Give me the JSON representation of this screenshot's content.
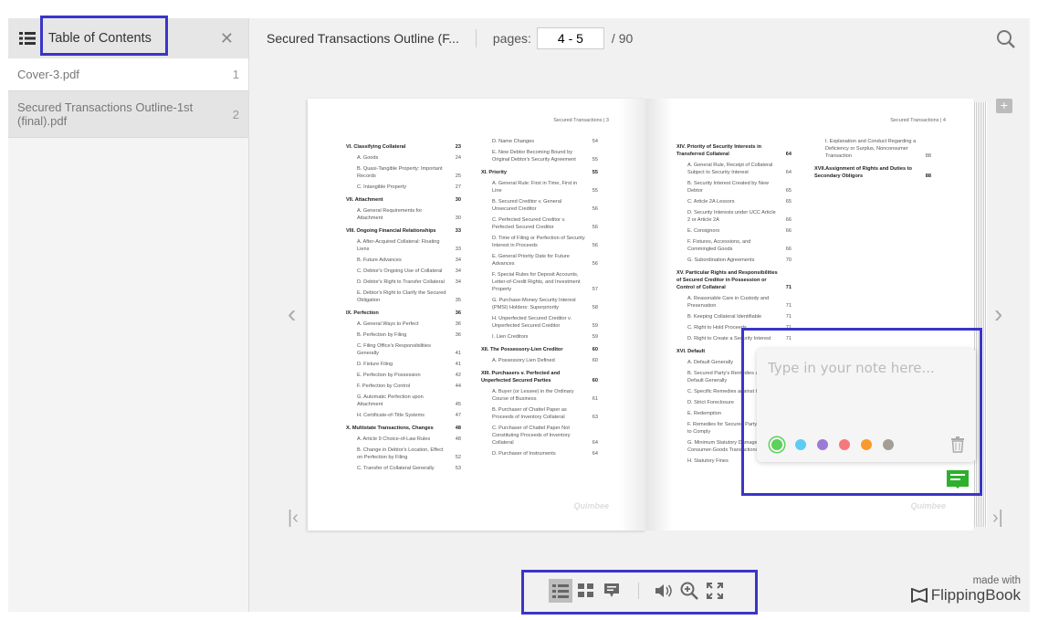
{
  "sidebar": {
    "title": "Table of Contents",
    "items": [
      {
        "label": "Cover-3.pdf",
        "page": "1"
      },
      {
        "label": "Secured Transactions Outline-1st (final).pdf",
        "page": "2"
      }
    ]
  },
  "header": {
    "doc_title": "Secured Transactions Outline (F...",
    "pages_label": "pages:",
    "pages_value": "4 - 5",
    "total": "/ 90"
  },
  "left_page": {
    "running_head": "Secured Transactions  |  3",
    "watermark": "Quimbee",
    "col1": [
      {
        "k": "sec",
        "t": "VI.  Classifying Collateral",
        "p": "23"
      },
      {
        "k": "sub",
        "t": "A. Goods",
        "p": "24"
      },
      {
        "k": "sub",
        "t": "B. Quasi-Tangible Property: Important Records",
        "p": "25"
      },
      {
        "k": "sub",
        "t": "C. Intangible Property",
        "p": "27"
      },
      {
        "k": "sec",
        "t": "VII. Attachment",
        "p": "30"
      },
      {
        "k": "sub",
        "t": "A. General Requirements for Attachment",
        "p": "30"
      },
      {
        "k": "sec",
        "t": "VIII.  Ongoing Financial Relationships",
        "p": "33"
      },
      {
        "k": "sub",
        "t": "A. After-Acquired Collateral: Floating Liens",
        "p": "33"
      },
      {
        "k": "sub",
        "t": "B. Future Advances",
        "p": "34"
      },
      {
        "k": "sub",
        "t": "C. Debtor's Ongoing Use of Collateral",
        "p": "34"
      },
      {
        "k": "sub",
        "t": "D. Debtor's Right to Transfer Collateral",
        "p": "34"
      },
      {
        "k": "sub",
        "t": "E. Debtor's Right to Clarify the Secured Obligation",
        "p": "35"
      },
      {
        "k": "sec",
        "t": "IX.  Perfection",
        "p": "36"
      },
      {
        "k": "sub",
        "t": "A. General Ways to Perfect",
        "p": "36"
      },
      {
        "k": "sub",
        "t": "B. Perfection by Filing",
        "p": "36"
      },
      {
        "k": "sub",
        "t": "C. Filing Office's Responsibilities Generally",
        "p": "41"
      },
      {
        "k": "sub",
        "t": "D. Fixture Filing",
        "p": "41"
      },
      {
        "k": "sub",
        "t": "E. Perfection by Possession",
        "p": "42"
      },
      {
        "k": "sub",
        "t": "F. Perfection by Control",
        "p": "44"
      },
      {
        "k": "sub",
        "t": "G. Automatic Perfection upon Attachment",
        "p": "45"
      },
      {
        "k": "sub",
        "t": "H. Certificate-of-Title Systems",
        "p": "47"
      },
      {
        "k": "sec",
        "t": "X.  Multistate Transactions, Changes",
        "p": "48"
      },
      {
        "k": "sub",
        "t": "A. Article 9 Choice-of-Law Rules",
        "p": "48"
      },
      {
        "k": "sub",
        "t": "B. Change in Debtor's Location, Effect on Perfection by Filing",
        "p": "52"
      },
      {
        "k": "sub",
        "t": "C. Transfer of Collateral Generally",
        "p": "53"
      }
    ],
    "col2": [
      {
        "k": "sub",
        "t": "D. Name Changes",
        "p": "54"
      },
      {
        "k": "sub",
        "t": "E. New Debtor Becoming Bound by Original Debtor's Security Agreement",
        "p": "55"
      },
      {
        "k": "sec",
        "t": "XI.  Priority",
        "p": "55"
      },
      {
        "k": "sub",
        "t": "A. General Rule: First in Time, First in Line",
        "p": "55"
      },
      {
        "k": "sub",
        "t": "B. Secured Creditor v. General Unsecured Creditor",
        "p": "56"
      },
      {
        "k": "sub",
        "t": "C. Perfected Secured Creditor v. Perfected Secured Creditor",
        "p": "56"
      },
      {
        "k": "sub",
        "t": "D. Time of Filing or Perfection of Security Interest in Proceeds",
        "p": "56"
      },
      {
        "k": "sub",
        "t": "E. General Priority Date for Future Advances",
        "p": "56"
      },
      {
        "k": "sub",
        "t": "F. Special Rules for Deposit Accounts, Letter-of-Credit Rights, and Investment Property",
        "p": "57"
      },
      {
        "k": "sub",
        "t": "G. Purchase-Money Security Interest (PMSI) Holders: Superpriority",
        "p": "58"
      },
      {
        "k": "sub",
        "t": "H. Unperfected Secured Creditor v. Unperfected Secured Creditor",
        "p": "59"
      },
      {
        "k": "sub",
        "t": "I.  Lien Creditors",
        "p": "59"
      },
      {
        "k": "sec",
        "t": "XII. The Possessory-Lien Creditor",
        "p": "60"
      },
      {
        "k": "sub",
        "t": "A. Possessory Lien Defined",
        "p": "60"
      },
      {
        "k": "sec",
        "t": "XIII.  Purchasers v. Perfected and Unperfected Secured Parties",
        "p": "60"
      },
      {
        "k": "sub",
        "t": "A. Buyer (or Lessee) in the Ordinary Course of Business",
        "p": "61"
      },
      {
        "k": "sub",
        "t": "B. Purchaser of Chattel Paper as Proceeds of Inventory Collateral",
        "p": "63"
      },
      {
        "k": "sub",
        "t": "C. Purchaser of Chattel Paper Not Constituting Proceeds of Inventory Collateral",
        "p": "64"
      },
      {
        "k": "sub",
        "t": "D. Purchaser of Instruments",
        "p": "64"
      }
    ]
  },
  "right_page": {
    "running_head": "Secured Transactions  |  4",
    "watermark": "Quimbee",
    "col1": [
      {
        "k": "sec",
        "t": "XIV. Priority of Security Interests in Transferred Collateral",
        "p": "64"
      },
      {
        "k": "sub",
        "t": "A. General Rule, Receipt of Collateral Subject to Security Interest",
        "p": "64"
      },
      {
        "k": "sub",
        "t": "B. Security Interest Created by New Debtor",
        "p": "65"
      },
      {
        "k": "sub",
        "t": "C. Article 2A Lessors",
        "p": "65"
      },
      {
        "k": "sub",
        "t": "D. Security Interests under UCC Article 2 or Article 2A",
        "p": "66"
      },
      {
        "k": "sub",
        "t": "E. Consignors",
        "p": "66"
      },
      {
        "k": "sub",
        "t": "F. Fixtures, Accessions, and Commingled Goods",
        "p": "66"
      },
      {
        "k": "sub",
        "t": "G. Subordination Agreements",
        "p": "70"
      },
      {
        "k": "sec",
        "t": "XV. Particular Rights and Responsibilities of Secured Creditor in Possession or Control of Collateral",
        "p": "71"
      },
      {
        "k": "sub",
        "t": "A. Reasonable Care in Custody and Preservation",
        "p": "71"
      },
      {
        "k": "sub",
        "t": "B. Keeping Collateral Identifiable",
        "p": "71"
      },
      {
        "k": "sub",
        "t": "C. Right to Hold Proceeds",
        "p": "71"
      },
      {
        "k": "sub",
        "t": "D. Right to Create a Security Interest",
        "p": "71"
      },
      {
        "k": "sec",
        "t": "XVI.  Default",
        "p": ""
      },
      {
        "k": "sub",
        "t": "A. Default Generally",
        "p": ""
      },
      {
        "k": "sub",
        "t": "B. Secured Party's Remedies after Default Generally",
        "p": ""
      },
      {
        "k": "sub",
        "t": "C. Specific Remedies against Collateral",
        "p": ""
      },
      {
        "k": "sub",
        "t": "D. Strict Foreclosure",
        "p": ""
      },
      {
        "k": "sub",
        "t": "E. Redemption",
        "p": ""
      },
      {
        "k": "sub",
        "t": "F. Remedies for Secured Party's Failure to Comply",
        "p": ""
      },
      {
        "k": "sub",
        "t": "G. Minimum Statutory Damages in Consumer-Goods Transactions",
        "p": ""
      },
      {
        "k": "sub",
        "t": "H. Statutory Fines",
        "p": "88"
      }
    ],
    "col2": [
      {
        "k": "sub",
        "t": "I.  Explanation and Conduct Regarding a Deficiency or Surplus, Nonconsumer Transaction",
        "p": "88"
      },
      {
        "k": "sec",
        "t": "XVII.Assignment of Rights and Duties to Secondary Obligors",
        "p": "88"
      }
    ]
  },
  "note": {
    "placeholder": "Type in your note here...",
    "colors": [
      "#5cd15c",
      "#5ccdf5",
      "#9b7bd6",
      "#f7777f",
      "#fa9a2e",
      "#a59e96"
    ],
    "selected_color": "#5cd15c"
  },
  "toolbar": {
    "items": [
      "toc",
      "thumbnails",
      "notes",
      "sound",
      "zoom",
      "fullscreen"
    ],
    "active": "toc"
  },
  "brand": {
    "made_with": "made with",
    "name": "FlippingBook"
  },
  "colors": {
    "highlight": "#3a35c8",
    "note_marker": "#2db02d"
  }
}
